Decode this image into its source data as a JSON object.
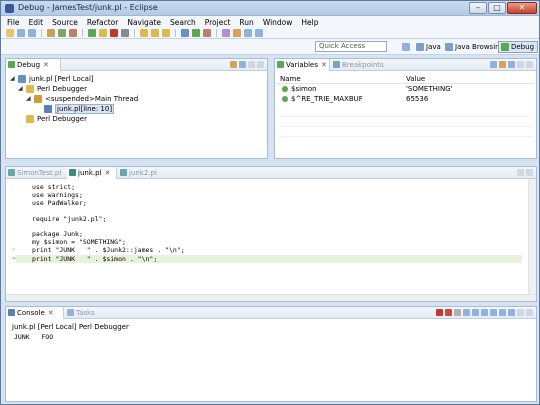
{
  "window": {
    "title": "Debug - JamesTest/junk.pl - Eclipse"
  },
  "menu": [
    "File",
    "Edit",
    "Source",
    "Refactor",
    "Navigate",
    "Search",
    "Project",
    "Run",
    "Window",
    "Help"
  ],
  "quick_access": {
    "placeholder": "Quick Access"
  },
  "perspectives": [
    {
      "label": "Java",
      "active": false
    },
    {
      "label": "Java Browsing",
      "active": false
    },
    {
      "label": "Debug",
      "active": true
    }
  ],
  "debug_view": {
    "tab": "Debug",
    "tree": [
      {
        "label": "junk.pl [Perl Local]",
        "level": 0,
        "expanded": true
      },
      {
        "label": "Perl Debugger",
        "level": 1,
        "expanded": true
      },
      {
        "label": "<suspended>Main Thread",
        "level": 2,
        "expanded": true
      },
      {
        "label": "junk.pl[line: 10]",
        "level": 3,
        "selected": true
      },
      {
        "label": "Perl Debugger",
        "level": 1
      }
    ]
  },
  "variables_view": {
    "tabs": [
      "Variables",
      "Breakpoints"
    ],
    "columns": [
      "Name",
      "Value"
    ],
    "rows": [
      {
        "name": "$simon",
        "value": "'SOMETHING'"
      },
      {
        "name": "$^RE_TRIE_MAXBUF",
        "value": "65536"
      }
    ]
  },
  "editor": {
    "tabs": [
      "SimonTest.pl",
      "junk.pl",
      "junk2.pl"
    ],
    "active_tab": 1,
    "lines": [
      "use strict;",
      "use warnings;",
      "use PadWalker;",
      "",
      "require \"junk2.pl\";",
      "",
      "package Junk;",
      "my $simon = \"SOMETHING\";",
      "print \"JUNK   \" . $Junk2::james . \"\\n\";",
      "print \"JUNK   \" . $simon . \"\\n\";"
    ],
    "current_line": 10
  },
  "console": {
    "tabs": [
      "Console",
      "Tasks"
    ],
    "label": "junk.pl [Perl Local] Perl Debugger",
    "output": "JUNK   FOO"
  }
}
